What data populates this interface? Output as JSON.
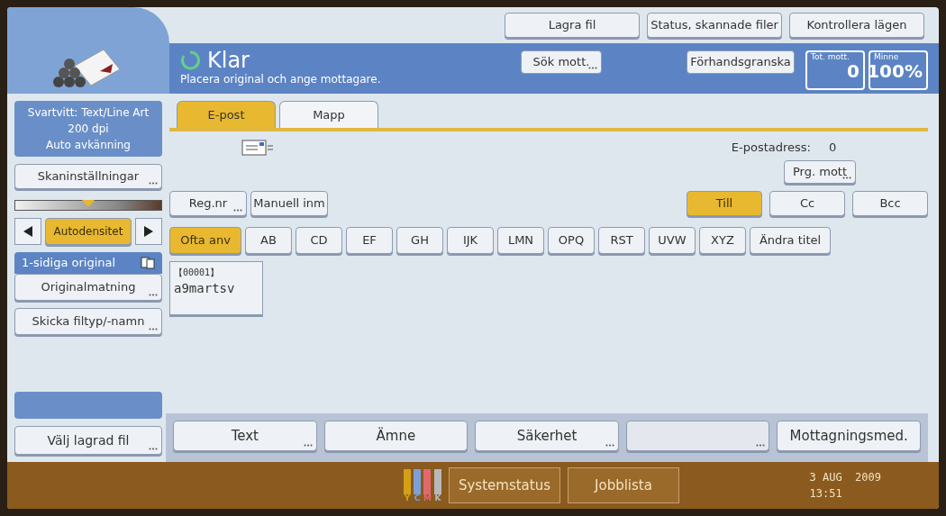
{
  "top_buttons": [
    {
      "label": "Lagra fil"
    },
    {
      "label": "Status, skannade filer"
    },
    {
      "label": "Kontrollera lägen"
    }
  ],
  "header": {
    "status": "Klar",
    "message": "Placera original och ange mottagare.",
    "search_button": {
      "label": "Sök mott.",
      "more": true
    },
    "preview_button": {
      "label": "Förhandsgranska"
    },
    "counters": [
      {
        "label": "Tot. mott.",
        "value": "0"
      },
      {
        "label": "Minne",
        "value": "100%"
      }
    ]
  },
  "left": {
    "scan_summary": [
      "Svartvitt: Text/Line Art",
      "200 dpi",
      "Auto avkänning"
    ],
    "scan_settings": {
      "label": "Skaninställningar",
      "more": true
    },
    "density": {
      "level": 0.5
    },
    "density_mode": {
      "label": "Autodensitet",
      "selected": true
    },
    "original_type": {
      "label": "1-sidiga original"
    },
    "feed": {
      "label": "Originalmatning",
      "more": true
    },
    "file_type": {
      "label": "Skicka filtyp/-namn",
      "more": true
    },
    "stored": {
      "label": "Välj lagrad fil",
      "more": true
    }
  },
  "tabs": [
    {
      "label": "E-post",
      "selected": true
    },
    {
      "label": "Mapp",
      "selected": false
    }
  ],
  "address_count": {
    "label": "E-postadress:",
    "value": "0"
  },
  "prg_button": {
    "label": "Prg. mott",
    "more": true
  },
  "entry_buttons": [
    {
      "label": "Reg.nr",
      "more": true
    },
    {
      "label": "Manuell inm",
      "more": false
    }
  ],
  "recipient_types": [
    {
      "label": "Till",
      "selected": true
    },
    {
      "label": "Cc",
      "selected": false
    },
    {
      "label": "Bcc",
      "selected": false
    }
  ],
  "index_tabs": [
    {
      "label": "Ofta anv",
      "selected": true
    },
    {
      "label": "AB",
      "selected": false
    },
    {
      "label": "CD",
      "selected": false
    },
    {
      "label": "EF",
      "selected": false
    },
    {
      "label": "GH",
      "selected": false
    },
    {
      "label": "IJK",
      "selected": false
    },
    {
      "label": "LMN",
      "selected": false
    },
    {
      "label": "OPQ",
      "selected": false
    },
    {
      "label": "RST",
      "selected": false
    },
    {
      "label": "UVW",
      "selected": false
    },
    {
      "label": "XYZ",
      "selected": false
    },
    {
      "label": "Ändra titel",
      "selected": false
    }
  ],
  "destinations": [
    {
      "number": "【00001】",
      "name": "a9martsv"
    }
  ],
  "bottom_buttons": [
    {
      "label": "Text",
      "more": true,
      "disabled": false
    },
    {
      "label": "Ämne",
      "more": false,
      "disabled": false
    },
    {
      "label": "Säkerhet",
      "more": true,
      "disabled": false
    },
    {
      "more": true,
      "disabled": true
    },
    {
      "label": "Mottagningsmed.",
      "more": false,
      "disabled": false
    }
  ],
  "status_bar": {
    "toners": [
      {
        "label": "Y",
        "color": "#d4a017"
      },
      {
        "label": "C",
        "color": "#7d9fd8"
      },
      {
        "label": "M",
        "color": "#e06a6a"
      },
      {
        "label": "K",
        "color": "#b8b8b8"
      }
    ],
    "buttons": [
      {
        "label": "Systemstatus"
      },
      {
        "label": "Jobblista"
      }
    ],
    "date": "3 AUG  2009",
    "time": "13:51"
  }
}
